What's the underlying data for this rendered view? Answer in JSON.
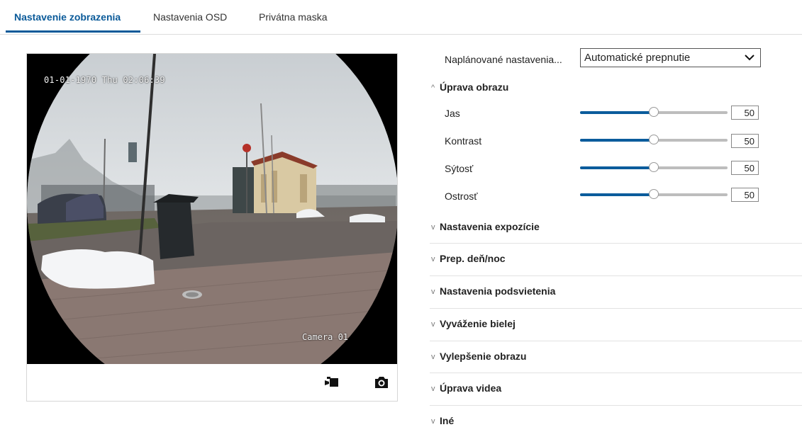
{
  "tabs": [
    {
      "label": "Nastavenie zobrazenia",
      "active": true
    },
    {
      "label": "Nastavenia OSD",
      "active": false
    },
    {
      "label": "Privátna maska",
      "active": false
    }
  ],
  "video": {
    "osd_datetime": "01-01-1970 Thu 02:06:39",
    "osd_camera_name": "Camera 01",
    "toolbar": {
      "record_icon": "video-camera-icon",
      "snapshot_icon": "camera-icon"
    }
  },
  "schedule": {
    "label": "Naplánované nastavenia...",
    "selected": "Automatické prepnutie"
  },
  "image_adjust": {
    "title": "Úprava obrazu",
    "expanded": true,
    "rows": [
      {
        "label": "Jas",
        "value": "50",
        "percent": 50
      },
      {
        "label": "Kontrast",
        "value": "50",
        "percent": 50
      },
      {
        "label": "Sýtosť",
        "value": "50",
        "percent": 50
      },
      {
        "label": "Ostrosť",
        "value": "50",
        "percent": 50
      }
    ]
  },
  "sections": [
    {
      "title": "Nastavenia expozície"
    },
    {
      "title": "Prep. deň/noc"
    },
    {
      "title": "Nastavenia podsvietenia"
    },
    {
      "title": "Vyváženie bielej"
    },
    {
      "title": "Vylepšenie obrazu"
    },
    {
      "title": "Úprava videa"
    },
    {
      "title": "Iné"
    }
  ],
  "colors": {
    "accent": "#0a5a99",
    "slider_fill": "#0b5c9c",
    "slider_track": "#bdbdbd"
  }
}
